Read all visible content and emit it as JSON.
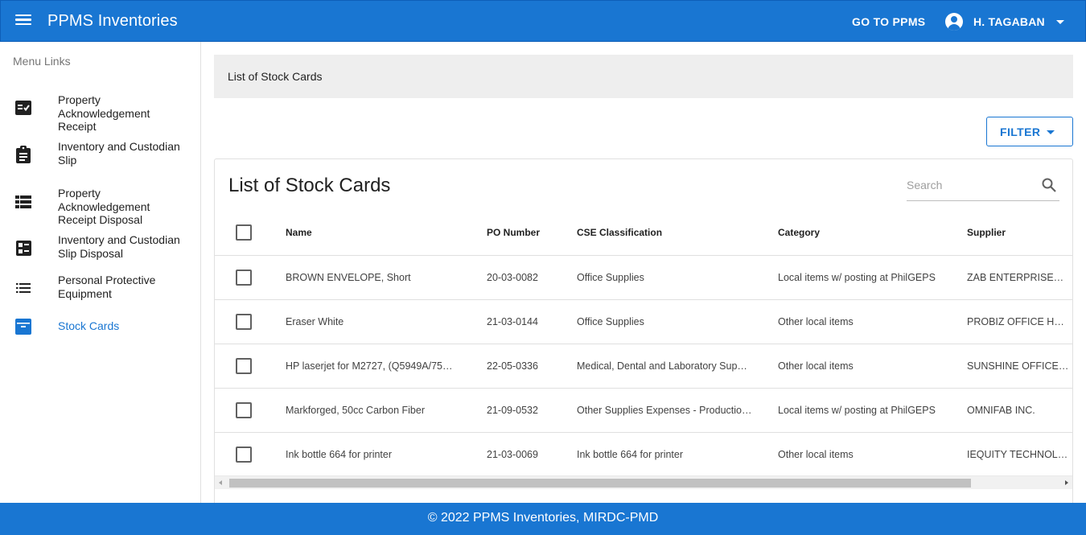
{
  "appbar": {
    "title": "PPMS Inventories",
    "goto_label": "GO TO PPMS",
    "user_name": "H. TAGABAN",
    "accent": "#1976d2"
  },
  "sidebar": {
    "heading": "Menu Links",
    "items": [
      {
        "label": "Property Acknowledgement Receipt",
        "icon": "fact-check-icon"
      },
      {
        "label": "Inventory and Custodian Slip",
        "icon": "assignment-icon"
      },
      {
        "label": "Property Acknowledgement Receipt Disposal",
        "icon": "view-list-icon"
      },
      {
        "label": "Inventory and Custodian Slip Disposal",
        "icon": "ballot-icon"
      },
      {
        "label": "Personal Protective Equipment",
        "icon": "list-icon"
      },
      {
        "label": "Stock Cards",
        "icon": "archive-icon",
        "active": true
      }
    ]
  },
  "breadcrumb": "List of Stock Cards",
  "filter_label": "FILTER",
  "card": {
    "title": "List of Stock Cards",
    "search_placeholder": "Search"
  },
  "table": {
    "columns": [
      "Name",
      "PO Number",
      "CSE Classification",
      "Category",
      "Supplier"
    ],
    "rows": [
      {
        "name": "BROWN ENVELOPE, Short",
        "po": "20-03-0082",
        "cse": "Office Supplies",
        "category": "Local items w/ posting at PhilGEPS",
        "supplier": "ZAB ENTERPRISE…"
      },
      {
        "name": "Eraser White",
        "po": "21-03-0144",
        "cse": "Office Supplies",
        "category": "Other local items",
        "supplier": "PROBIZ OFFICE H…"
      },
      {
        "name": "HP laserjet for M2727, (Q5949A/75…",
        "po": "22-05-0336",
        "cse": "Medical, Dental and Laboratory Sup…",
        "category": "Other local items",
        "supplier": "SUNSHINE OFFICE…"
      },
      {
        "name": "Markforged, 50cc Carbon Fiber",
        "po": "21-09-0532",
        "cse": "Other Supplies Expenses - Productio…",
        "category": "Local items w/ posting at PhilGEPS",
        "supplier": "OMNIFAB INC."
      },
      {
        "name": "Ink bottle 664 for printer",
        "po": "21-03-0069",
        "cse": "Ink bottle 664 for printer",
        "category": "Other local items",
        "supplier": "IEQUITY TECHNOL…"
      }
    ]
  },
  "footer": "© 2022 PPMS Inventories, MIRDC-PMD"
}
